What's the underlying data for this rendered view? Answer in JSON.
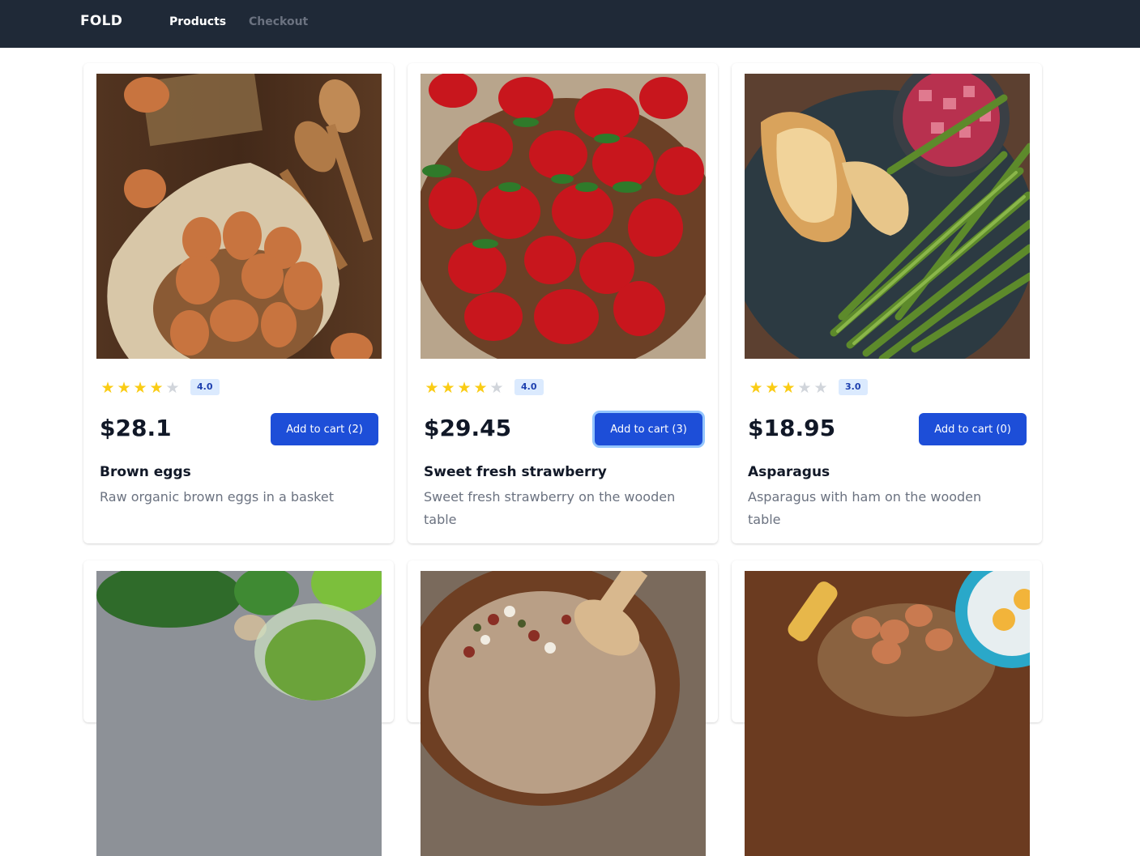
{
  "nav": {
    "brand": "FOLD",
    "links": [
      {
        "label": "Products",
        "active": true
      },
      {
        "label": "Checkout",
        "active": false
      }
    ]
  },
  "colors": {
    "navbar": "#1f2937",
    "accent": "#1d4ed8",
    "star_filled": "#facc15",
    "star_empty": "#d1d5db",
    "badge_bg": "#dbeafe"
  },
  "products": [
    {
      "image": "brown-eggs-photo",
      "rating": 4,
      "rating_label": "4.0",
      "price": "$28.1",
      "cart_label": "Add to cart (2)",
      "name": "Brown eggs",
      "description": "Raw organic brown eggs in a basket"
    },
    {
      "image": "strawberries-photo",
      "rating": 4,
      "rating_label": "4.0",
      "price": "$29.45",
      "cart_label": "Add to cart (3)",
      "name": "Sweet fresh strawberry",
      "description": "Sweet fresh strawberry on the wooden table"
    },
    {
      "image": "asparagus-photo",
      "rating": 3,
      "rating_label": "3.0",
      "price": "$18.95",
      "cart_label": "Add to cart (0)",
      "name": "Asparagus",
      "description": "Asparagus with ham on the wooden table"
    }
  ],
  "more_products_images": [
    "green-smoothie-photo",
    "mixed-beans-photo",
    "eggs-basket-photo"
  ]
}
